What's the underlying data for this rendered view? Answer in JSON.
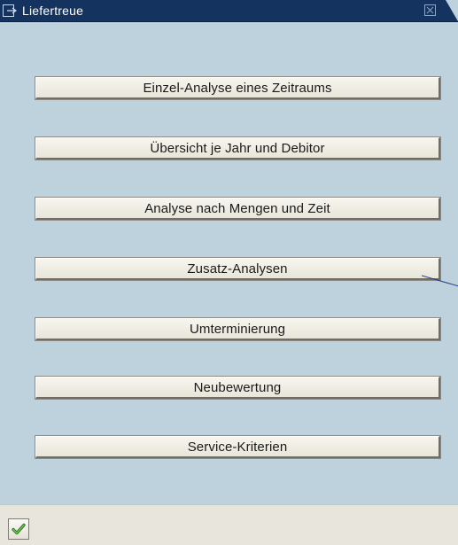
{
  "window": {
    "title": "Liefertreue"
  },
  "menu": {
    "buttons": [
      {
        "label": "Einzel-Analyse eines Zeitraums"
      },
      {
        "label": "Übersicht je Jahr und Debitor"
      },
      {
        "label": "Analyse nach Mengen und Zeit"
      },
      {
        "label": "Zusatz-Analysen"
      },
      {
        "label": "Umterminierung"
      },
      {
        "label": "Neubewertung"
      },
      {
        "label": "Service-Kriterien"
      }
    ]
  },
  "footer": {
    "ok_icon": "checkmark-icon"
  },
  "colors": {
    "titlebar": "#14335f",
    "background": "#bdd2dc",
    "button_face": "#efede4",
    "footer": "#e8e6dc",
    "check": "#2f8a2f"
  }
}
